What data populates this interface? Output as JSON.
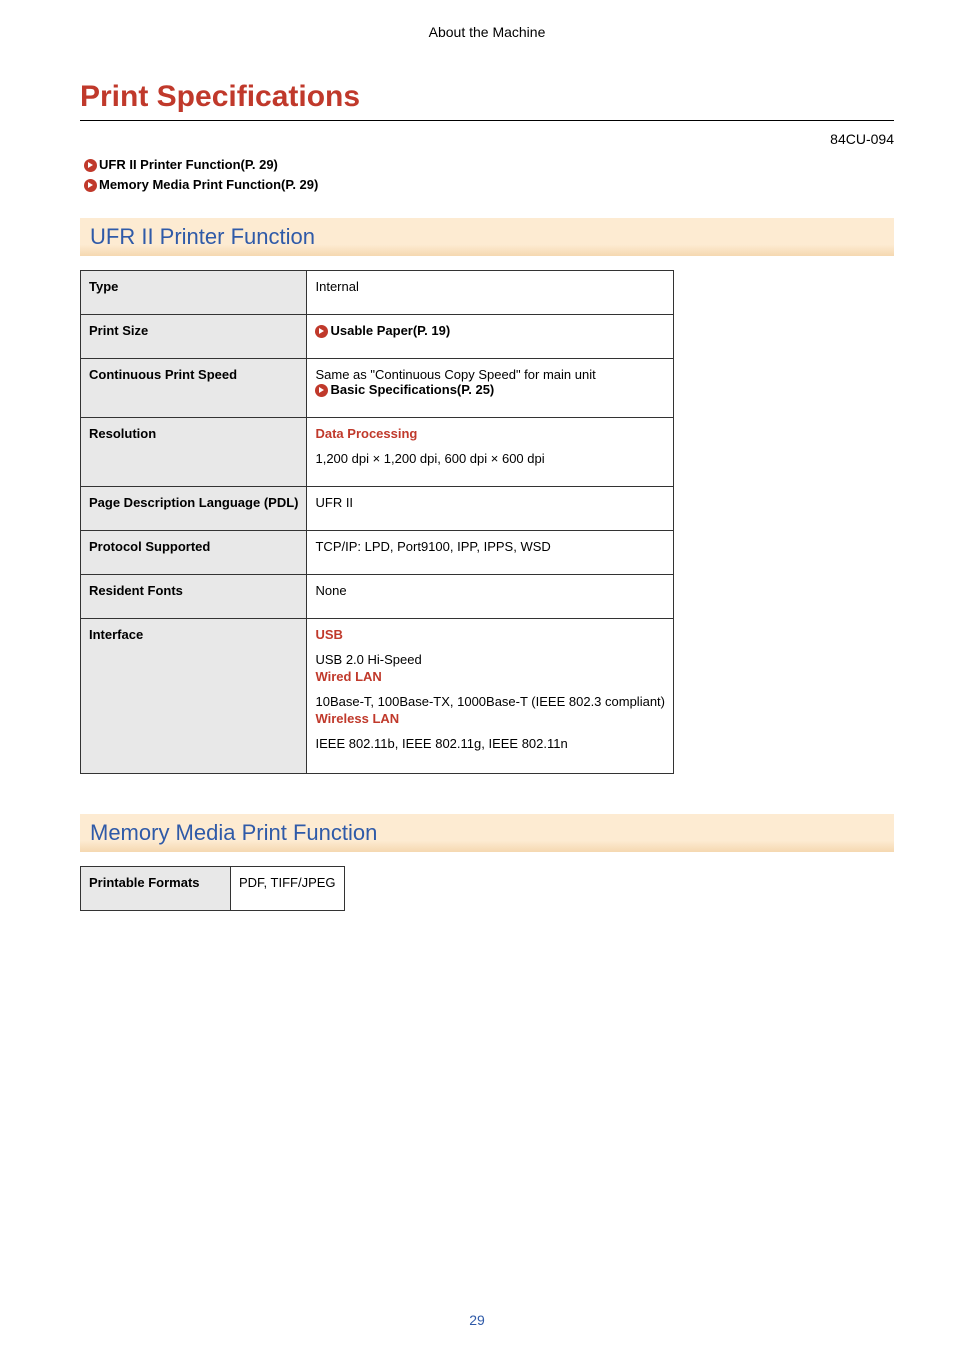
{
  "header": "About the Machine",
  "title": "Print Specifications",
  "doc_code": "84CU-094",
  "links": [
    "UFR II Printer Function(P. 29)",
    "Memory Media Print Function(P. 29)"
  ],
  "section1": {
    "heading": "UFR II Printer Function",
    "rows": {
      "type_label": "Type",
      "type_value": "Internal",
      "printsize_label": "Print Size",
      "printsize_link": "Usable Paper(P. 19)",
      "cps_label": "Continuous Print Speed",
      "cps_text": "Same as \"Continuous Copy Speed\" for main unit",
      "cps_link": "Basic Specifications(P. 25)",
      "res_label": "Resolution",
      "res_head": "Data Processing",
      "res_value": "1,200 dpi × 1,200 dpi, 600 dpi × 600 dpi",
      "pdl_label": "Page Description Language (PDL)",
      "pdl_value": "UFR II",
      "proto_label": "Protocol Supported",
      "proto_value": "TCP/IP: LPD, Port9100, IPP, IPPS, WSD",
      "fonts_label": "Resident Fonts",
      "fonts_value": "None",
      "iface_label": "Interface",
      "iface_usb_head": "USB",
      "iface_usb_value": "USB 2.0 Hi-Speed",
      "iface_wlan_head": "Wired LAN",
      "iface_wlan_value": "10Base-T, 100Base-TX, 1000Base-T (IEEE 802.3 compliant)",
      "iface_wifi_head": "Wireless LAN",
      "iface_wifi_value": "IEEE 802.11b, IEEE 802.11g, IEEE 802.11n"
    }
  },
  "section2": {
    "heading": "Memory Media Print Function",
    "rows": {
      "fmt_label": "Printable Formats",
      "fmt_value": "PDF, TIFF/JPEG"
    }
  },
  "page_number": "29"
}
